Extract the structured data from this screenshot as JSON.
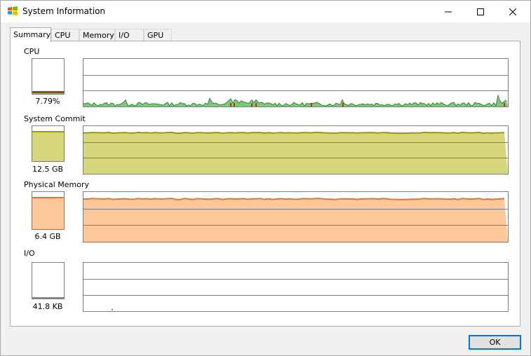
{
  "window": {
    "title": "System Information"
  },
  "tabs": [
    {
      "label": "Summary"
    },
    {
      "label": "CPU"
    },
    {
      "label": "Memory"
    },
    {
      "label": "I/O"
    },
    {
      "label": "GPU"
    }
  ],
  "sections": {
    "cpu": {
      "label": "CPU",
      "value": "7.79%",
      "level": 0.078
    },
    "commit": {
      "label": "System Commit",
      "value": "12.5 GB",
      "level": 0.86
    },
    "memory": {
      "label": "Physical Memory",
      "value": "6.4 GB",
      "level": 0.86
    },
    "io": {
      "label": "I/O",
      "value": "41.8  KB",
      "level": 0.0
    }
  },
  "footer": {
    "ok_label": "OK"
  },
  "colors": {
    "cpu_line": "#2a8a2a",
    "cpu_fill": "#7cc97c",
    "cpu_kernel": "#e02020",
    "commit_fill": "#d6d67a",
    "commit_line": "#9a9a00",
    "memory_fill": "#fdc99a",
    "memory_line": "#e8742a",
    "accent": "#0078d7"
  }
}
